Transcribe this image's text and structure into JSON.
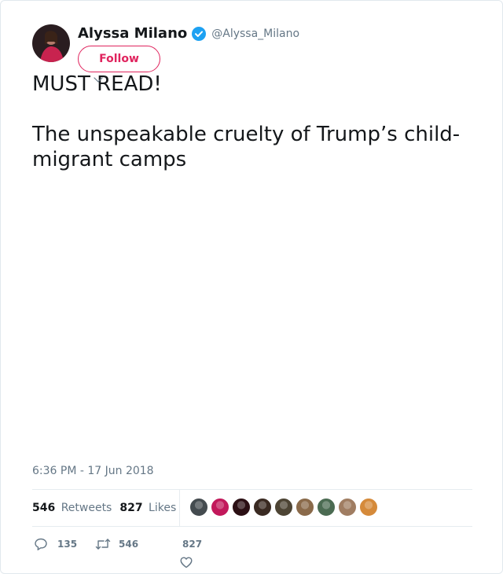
{
  "author": {
    "display_name": "Alyssa Milano",
    "handle": "@Alyssa_Milano",
    "verified": true,
    "follow_label": "Follow",
    "avatar_icon": "profile-photo"
  },
  "tweet": {
    "line1": "MUST READ!",
    "line2": "The unspeakable cruelty of Trump’s child-migrant camps",
    "timestamp": "6:36 PM - 17 Jun 2018"
  },
  "stats": {
    "retweets_count": "546",
    "retweets_label": "Retweets",
    "likes_count": "827",
    "likes_label": "Likes",
    "liker_avatar_colors": [
      "#444b4f",
      "#c2185b",
      "#2b0f14",
      "#3a2a22",
      "#4d4434",
      "#8a6a4a",
      "#4b6b52",
      "#a07d62",
      "#d58a3a"
    ]
  },
  "actions": {
    "reply_count": "135",
    "retweet_count": "546",
    "like_count": "827"
  },
  "colors": {
    "accent": "#e0245e",
    "verified_blue": "#1da1f2",
    "secondary_text": "#657786",
    "primary_text": "#14171a",
    "divider": "#e6ecf0"
  }
}
